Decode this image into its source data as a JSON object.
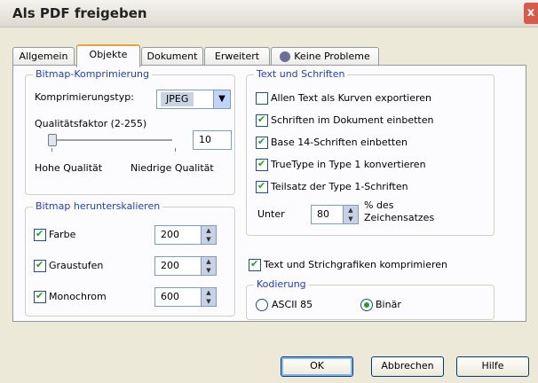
{
  "window": {
    "title": "Als PDF freigeben",
    "close_glyph": "x"
  },
  "tabs": [
    {
      "label": "Allgemein"
    },
    {
      "label": "Objekte"
    },
    {
      "label": "Dokument"
    },
    {
      "label": "Erweitert"
    },
    {
      "label": "Keine Probleme",
      "icon": "warning-icon"
    }
  ],
  "bitmap_compression": {
    "legend": "Bitmap-Komprimierung",
    "type_label": "Komprimierungstyp:",
    "type_value": "JPEG",
    "quality_label": "Qualitätsfaktor (2-255)",
    "quality_value": "10",
    "low_label": "Hohe Qualität",
    "high_label": "Niedrige Qualität"
  },
  "bitmap_downsample": {
    "legend": "Bitmap herunterskalieren",
    "rows": [
      {
        "label": "Farbe",
        "checked": true,
        "value": "200"
      },
      {
        "label": "Graustufen",
        "checked": true,
        "value": "200"
      },
      {
        "label": "Monochrom",
        "checked": true,
        "value": "600"
      }
    ]
  },
  "text_fonts": {
    "legend": "Text und Schriften",
    "options": [
      {
        "label": "Allen Text als Kurven exportieren",
        "checked": false
      },
      {
        "label": "Schriften im Dokument einbetten",
        "checked": true
      },
      {
        "label": "Base 14-Schriften einbetten",
        "checked": true
      },
      {
        "label": "TrueType in Type 1 konvertieren",
        "checked": true
      },
      {
        "label": "Teilsatz der Type 1-Schriften",
        "checked": true
      }
    ],
    "under_label": "Unter",
    "under_value": "80",
    "percent_line1": "% des",
    "percent_line2": "Zeichensatzes"
  },
  "compress": {
    "label": "Text und Strichgrafiken komprimieren",
    "checked": true
  },
  "encoding": {
    "legend": "Kodierung",
    "options": [
      {
        "label": "ASCII 85",
        "selected": false
      },
      {
        "label": "Binär",
        "selected": true
      }
    ]
  },
  "buttons": {
    "ok": "OK",
    "cancel": "Abbrechen",
    "help": "Hilfe"
  }
}
